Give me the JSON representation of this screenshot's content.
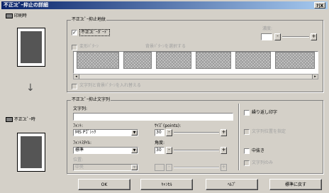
{
  "title": "不正ｺﾋﾟｰ抑止の詳細",
  "help": "?|X",
  "left": {
    "top_label": "印刷時",
    "bottom_label": "不正ｺﾋﾟｰ時",
    "arrow": "↓"
  },
  "protect": {
    "group": "不正ｺﾋﾟｰ抑止地紋",
    "enable_label": "不正ｺﾋﾟｰｶﾞｰﾄﾞ",
    "enable_checked": true,
    "density_label": "濃度:",
    "bg_pattern_label": "変形ﾊﾟﾀｰﾝ",
    "bg_pattern_hint": "背景ﾊﾟﾀｰﾝを選択する",
    "swap_label": "文字列と背景ﾊﾟﾀｰﾝを入れ替える"
  },
  "text": {
    "group": "不正ｺﾋﾟｰ抑止文字列",
    "string_label": "文字列:",
    "string_value": "",
    "font_label": "ﾌｫﾝﾄ:",
    "font_value": "MS Pｺﾞｼｯｸ",
    "size_label": "ｻｲｽﾞ(points):",
    "size_value": "30",
    "style_label": "ﾌｫﾝﾄｽﾀｲﾙ:",
    "style_value": "標準",
    "angle_label": "角度:",
    "angle_value": "30",
    "shadow_label": "位置:",
    "shadow_value": "中央",
    "repeat_label": "繰り返し印字",
    "pos_label": "文字列位置を指定",
    "outline_label": "中抜き",
    "outline2_label": "文字列のみ"
  },
  "buttons": {
    "ok": "OK",
    "cancel": "ｷｬﾝｾﾙ",
    "help": "ﾍﾙﾌﾟ",
    "default": "標準に戻す"
  }
}
